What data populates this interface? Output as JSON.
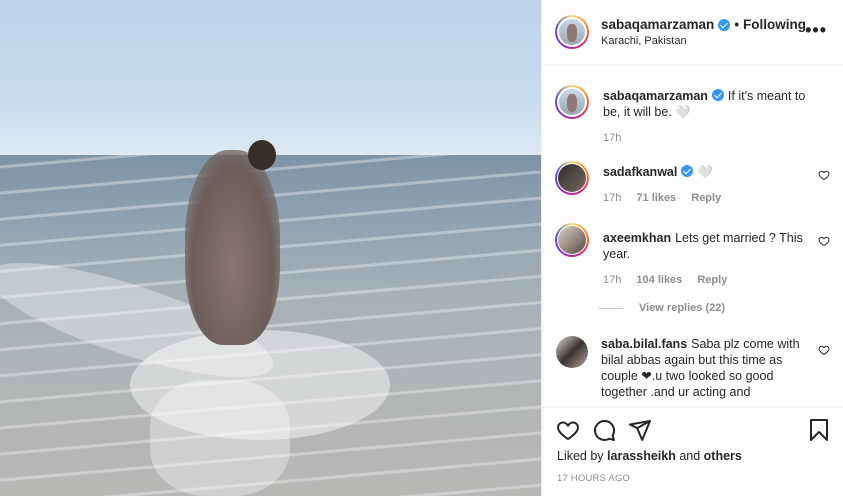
{
  "header": {
    "username": "sabaqamarzaman",
    "separator": "•",
    "follow_status": "Following",
    "location": "Karachi, Pakistan",
    "more": "•••"
  },
  "comments": [
    {
      "username": "sabaqamarzaman",
      "text": "If it's meant to be, it will be. 🤍",
      "time": "17h",
      "verified": true
    },
    {
      "username": "sadafkanwal",
      "text": "🤍",
      "time": "17h",
      "likes": "71 likes",
      "reply": "Reply",
      "verified": true
    },
    {
      "username": "axeemkhan",
      "text": "Lets get married ? This year.",
      "time": "17h",
      "likes": "104 likes",
      "reply": "Reply"
    },
    {
      "username": "saba.bilal.fans",
      "text": "Saba plz come with bilal abbas again but this time as couple ❤.u two looked so good together .and ur acting and"
    }
  ],
  "view_replies": "View replies (22)",
  "liked_by": {
    "prefix": "Liked by",
    "user": "larassheikh",
    "conj": "and",
    "others": "others"
  },
  "timestamp": "17 HOURS AGO",
  "colors": {
    "verified": "#3897f0",
    "meta": "#8e8e8e",
    "text": "#262626"
  },
  "icons": [
    "heart-icon",
    "comment-icon",
    "share-icon",
    "bookmark-icon",
    "more-icon"
  ]
}
